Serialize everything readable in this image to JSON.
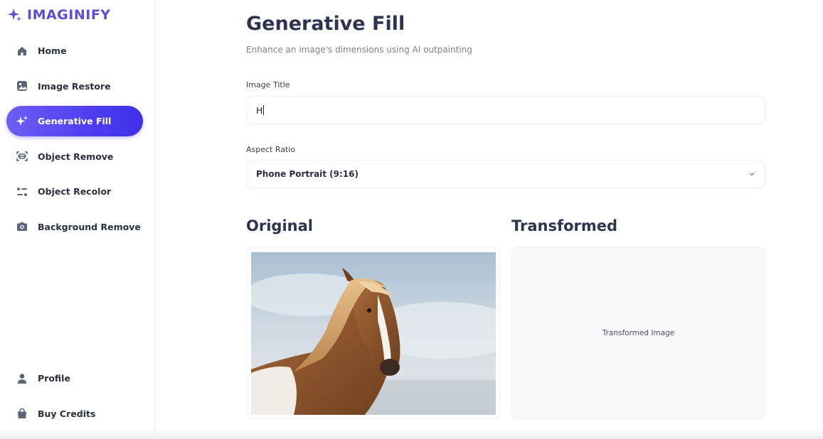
{
  "app": {
    "name": "IMAGINIFY",
    "brand_color": "#5b4fd6",
    "accent_gradient": [
      "#6d5ff2",
      "#3f2fe8"
    ]
  },
  "sidebar": {
    "items": [
      {
        "label": "Home",
        "icon": "home-icon",
        "active": false
      },
      {
        "label": "Image Restore",
        "icon": "image-icon",
        "active": false
      },
      {
        "label": "Generative Fill",
        "icon": "sparkles-icon",
        "active": true
      },
      {
        "label": "Object Remove",
        "icon": "scan-icon",
        "active": false
      },
      {
        "label": "Object Recolor",
        "icon": "filter-icon",
        "active": false
      },
      {
        "label": "Background Remove",
        "icon": "camera-icon",
        "active": false
      }
    ],
    "bottom_items": [
      {
        "label": "Profile",
        "icon": "user-icon"
      },
      {
        "label": "Buy Credits",
        "icon": "bag-icon"
      }
    ]
  },
  "page": {
    "title": "Generative Fill",
    "subtitle": "Enhance an image's dimensions using AI outpainting"
  },
  "form": {
    "title_label": "Image Title",
    "title_value": "H",
    "aspect_label": "Aspect Ratio",
    "aspect_value": "Phone Portrait (9:16)"
  },
  "original": {
    "heading": "Original",
    "image": "horse-photo"
  },
  "transformed": {
    "heading": "Transformed",
    "placeholder": "Transformed Image"
  }
}
